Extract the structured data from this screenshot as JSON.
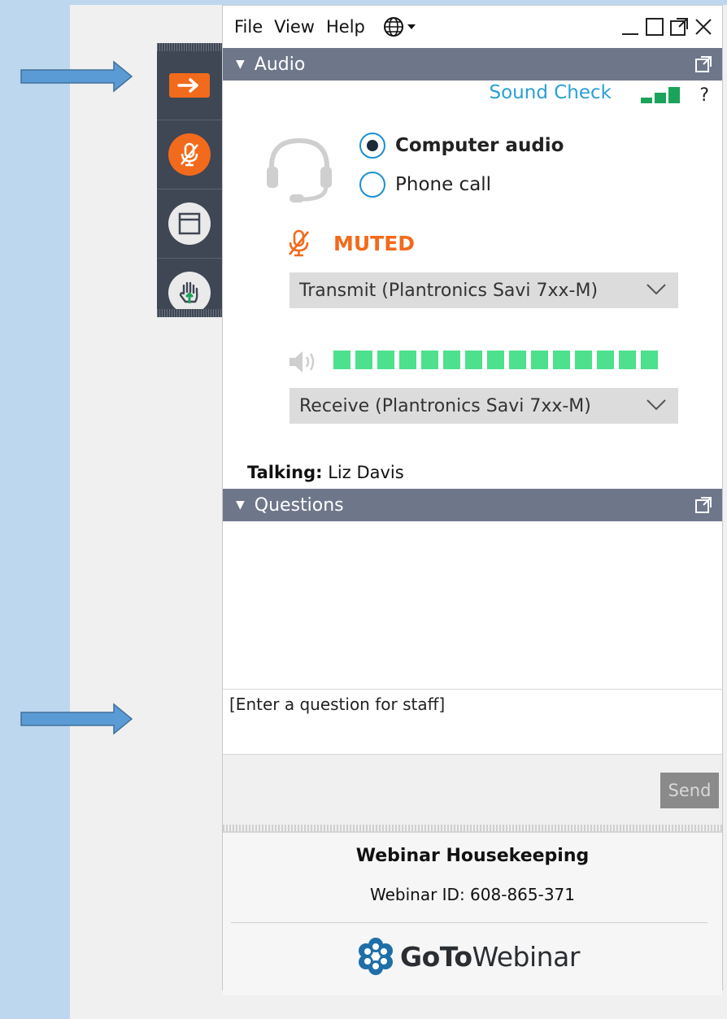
{
  "menu": {
    "file": "File",
    "view": "View",
    "help": "Help"
  },
  "audio": {
    "header": "Audio",
    "sound_check": "Sound Check",
    "help_glyph": "?",
    "computer_audio": "Computer audio",
    "phone_call": "Phone call",
    "muted": "MUTED",
    "transmit_device": "Transmit (Plantronics Savi 7xx-M)",
    "receive_device": "Receive (Plantronics Savi 7xx-M)",
    "talking_label": "Talking:",
    "talking_name": "Liz Davis"
  },
  "questions": {
    "header": "Questions",
    "input_placeholder": "[Enter a question for staff]",
    "send": "Send"
  },
  "footer": {
    "title": "Webinar Housekeeping",
    "webinar_id": "Webinar ID: 608-865-371",
    "logo_bold": "GoTo",
    "logo_rest": "Webinar"
  },
  "icons": {
    "arrow": "right-arrow-icon",
    "mic_muted": "microphone-muted-icon",
    "window": "window-icon",
    "hand": "raise-hand-icon",
    "globe": "globe-icon",
    "headset": "headset-icon",
    "speaker": "speaker-icon",
    "popout": "popout-icon"
  },
  "colors": {
    "accent_orange": "#f26a1b",
    "header_bar": "#6e778a",
    "strip": "#3f4654",
    "link_blue": "#2a9fd6",
    "level_green": "#4de08d",
    "signal_green": "#1aa35a",
    "background": "#bdd7ee"
  }
}
